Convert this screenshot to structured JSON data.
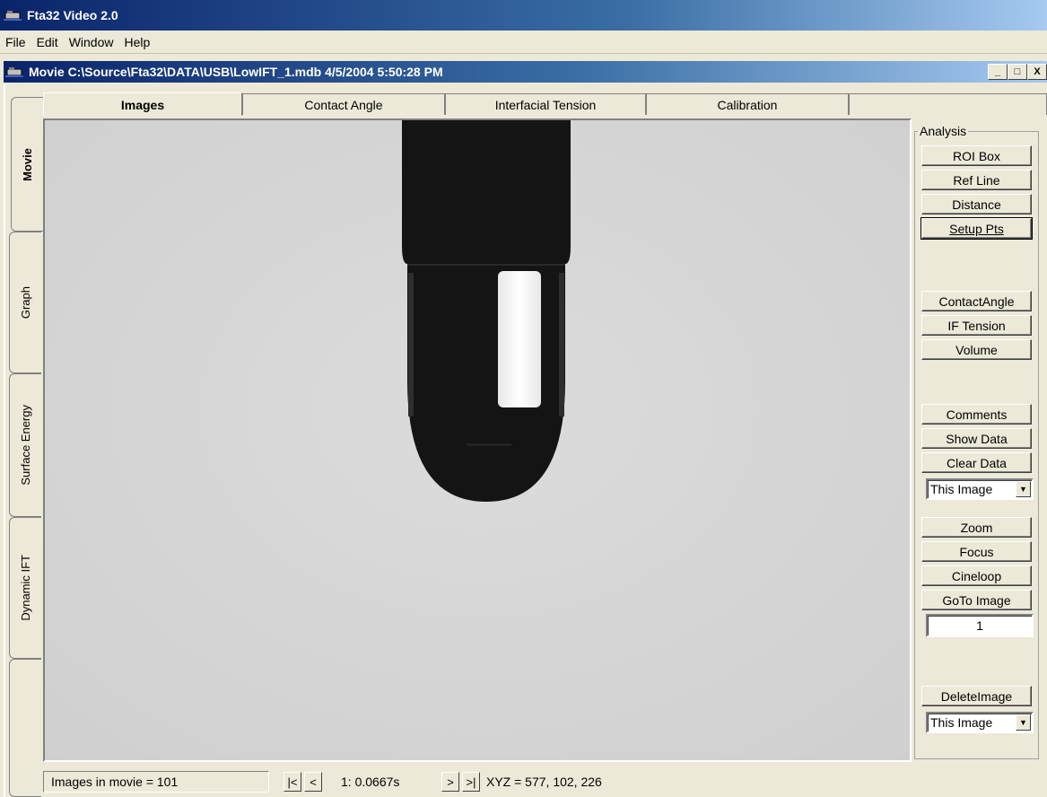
{
  "app": {
    "title": "Fta32 Video 2.0",
    "icon": "app-camera-icon"
  },
  "menu": [
    "File",
    "Edit",
    "Window",
    "Help"
  ],
  "child_window": {
    "title": "Movie C:\\Source\\Fta32\\DATA\\USB\\LowIFT_1.mdb 4/5/2004 5:50:28 PM",
    "minimize": "_",
    "maximize": "□",
    "close": "X"
  },
  "side_tabs": [
    "Movie",
    "Graph",
    "Surface Energy",
    "Dynamic IFT"
  ],
  "top_tabs": [
    "Images",
    "Contact Angle",
    "Interfacial Tension",
    "Calibration"
  ],
  "analysis": {
    "legend": "Analysis",
    "buttons_group1": [
      "ROI Box",
      "Ref Line",
      "Distance",
      "Setup Pts"
    ],
    "buttons_group2": [
      "ContactAngle",
      "IF Tension",
      "Volume"
    ],
    "buttons_group3": [
      "Comments",
      "Show Data",
      "Clear Data"
    ],
    "clear_select": "This Image",
    "buttons_group4": [
      "Zoom",
      "Focus",
      "Cineloop",
      "GoTo Image"
    ],
    "goto_value": "1",
    "delete_button": "DeleteImage",
    "delete_select": "This Image"
  },
  "status": {
    "images_count": "Images in movie = 101",
    "first": "|<",
    "prev": "<",
    "frame": "1:  0.0667s",
    "next": ">",
    "last": ">|",
    "xyz": "XYZ = 577, 102, 226"
  },
  "colors": {
    "titlebar": "#0a246a",
    "background": "#ece9d8",
    "image_bg": "#d6d6d6",
    "drop": "#141414"
  }
}
